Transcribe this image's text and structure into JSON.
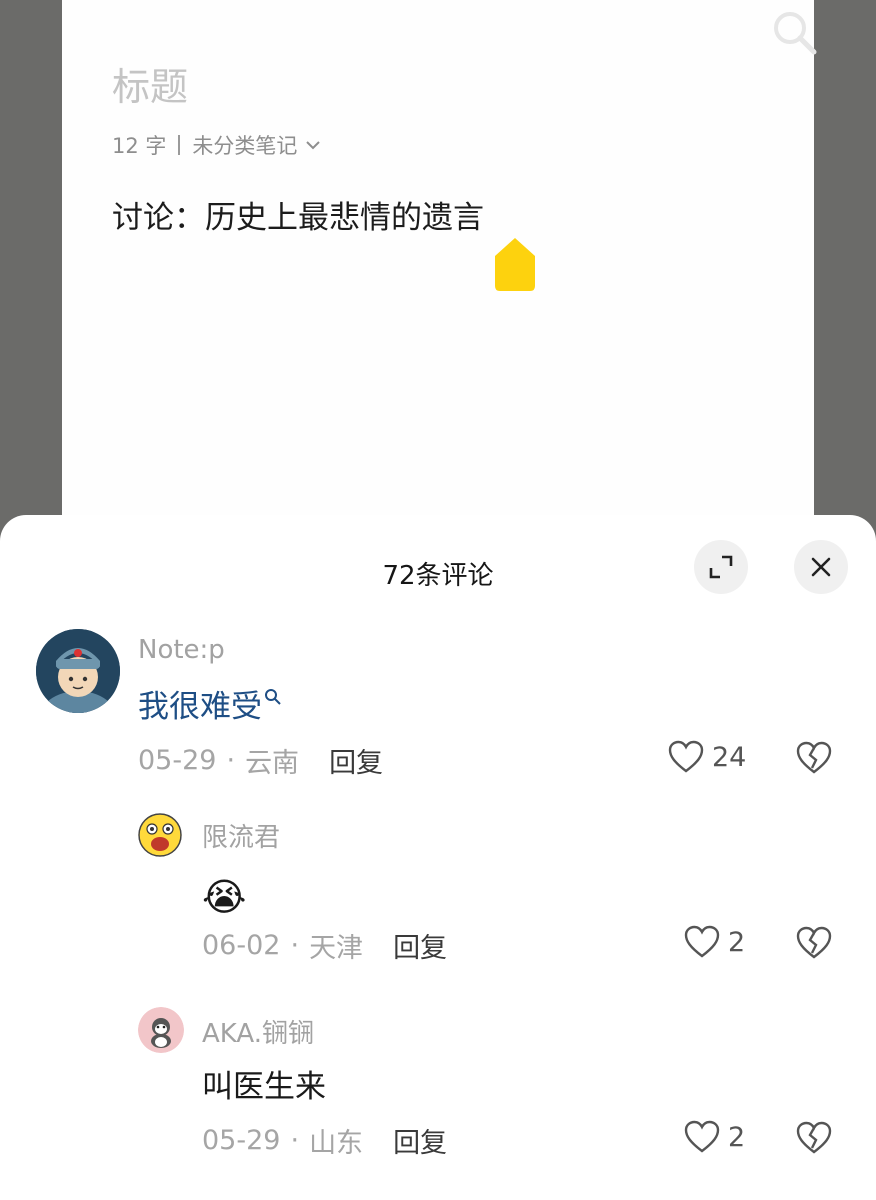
{
  "note": {
    "title_placeholder": "标题",
    "char_count": "12 字",
    "category": "未分类笔记",
    "body": "讨论：历史上最悲情的遗言"
  },
  "comments_panel": {
    "title": "72条评论",
    "comments": [
      {
        "username": "Note:p",
        "content": "我很难受",
        "date": "05-29",
        "location": "云南",
        "reply_label": "回复",
        "likes": "24"
      },
      {
        "username": "限流君",
        "content": "😭",
        "date": "06-02",
        "location": "天津",
        "reply_label": "回复",
        "likes": "2"
      },
      {
        "username": "AKA.锎锎",
        "content": "叫医生来",
        "date": "05-29",
        "location": "山东",
        "reply_label": "回复",
        "likes": "2"
      }
    ]
  },
  "colors": {
    "link": "#1e4e85",
    "cursor_handle": "#fdd20e",
    "backdrop": "#6b6b69"
  }
}
